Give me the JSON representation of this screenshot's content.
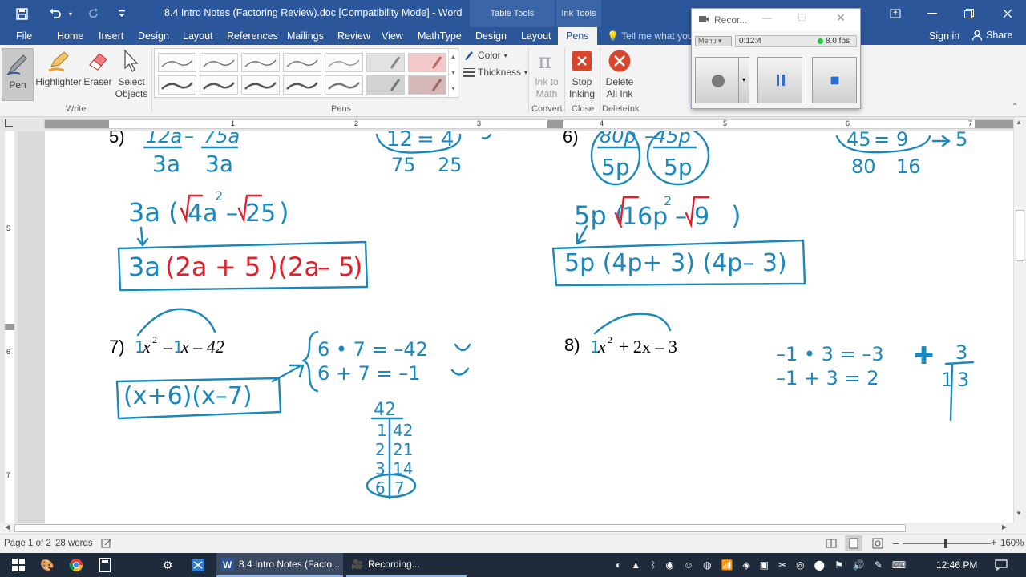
{
  "window": {
    "title": "8.4 Intro Notes (Factoring Review).doc [Compatibility Mode] - Word",
    "context_table": "Table Tools",
    "context_ink": "Ink Tools"
  },
  "tabs": [
    "File",
    "Home",
    "Insert",
    "Design",
    "Layout",
    "References",
    "Mailings",
    "Review",
    "View",
    "MathType",
    "Design",
    "Layout",
    "Pens"
  ],
  "tell_me": "Tell me what you",
  "sign_in": "Sign in",
  "share": "Share",
  "ribbon": {
    "write": {
      "pen": "Pen",
      "highlighter": "Highlighter",
      "eraser": "Eraser",
      "select": "Select Objects",
      "label": "Write"
    },
    "pens_label": "Pens",
    "color": "Color",
    "thickness": "Thickness",
    "convert": {
      "ink_to_math": "Ink to Math",
      "label": "Convert"
    },
    "close": {
      "stop_inking": "Stop Inking",
      "label": "Close"
    },
    "deleteink": {
      "delete_all": "Delete All Ink",
      "label": "DeleteInk"
    }
  },
  "recorder": {
    "title": "Recor...",
    "menu": "Menu",
    "time": "0:12:4",
    "fps": "8.0 fps"
  },
  "ruler": {
    "h": [
      "1",
      "2",
      "3",
      "4",
      "5",
      "6",
      "7"
    ],
    "v": [
      "5",
      "6",
      "7"
    ]
  },
  "math": {
    "p5": {
      "num": "5)",
      "t1": "12a",
      "t2": "75a",
      "d1": "3a",
      "d2": "3a",
      "f1": "12",
      "f2": "4",
      "f3": "75",
      "f4": "25",
      "s1": "3a (",
      "s2": "4a",
      "s3": "2",
      "s4": "25",
      "s5": ")",
      "b1": "3a",
      "b2": "(2a",
      "b3": "+ 5",
      "b4": ")(2a",
      "b5": "– 5",
      "b6": ")"
    },
    "p6": {
      "num": "6)",
      "t1": "80p",
      "t2": "–45p",
      "d1": "5p",
      "d2": "5p",
      "f1": "45",
      "f2": "9",
      "f3": "5",
      "f4": "80",
      "f5": "16",
      "s1": "5p (",
      "s2": "16p",
      "s3": "2",
      "s4": "9",
      "s5": ")",
      "box": "5p (4p+ 3) (4p– 3)"
    },
    "p7": {
      "num": "7)",
      "one": "1",
      "x": "x",
      "sq": "2",
      "minus": "–",
      "mid": "x – 42",
      "l1": "6 • 7 = –42",
      "l2": "6 + 7 = –1",
      "box": "(x+6)(x–7)",
      "c0": "42",
      "c1": "1",
      "c1b": "42",
      "c2": "2",
      "c2b": "21",
      "c3": "3",
      "c3b": "14",
      "c4": "6",
      "c4b": "7"
    },
    "p8": {
      "num": "8)",
      "one": "1",
      "x": "x",
      "sq": "2",
      "rest": "+ 2x – 3",
      "l1": "–1 • 3 = –3",
      "l2": "–1 + 3 = 2",
      "t1": "3",
      "t2": "1",
      "t3": "3"
    }
  },
  "status": {
    "page": "Page 1 of 2",
    "words": "28 words",
    "zoom": "160%"
  },
  "taskbar": {
    "word_app": "8.4 Intro Notes (Facto...",
    "rec_app": "Recording...",
    "clock": "12:46 PM"
  },
  "colors": {
    "word_blue": "#2b579a",
    "ink_blue": "#1b88bd",
    "ink_red": "#e0202a"
  }
}
